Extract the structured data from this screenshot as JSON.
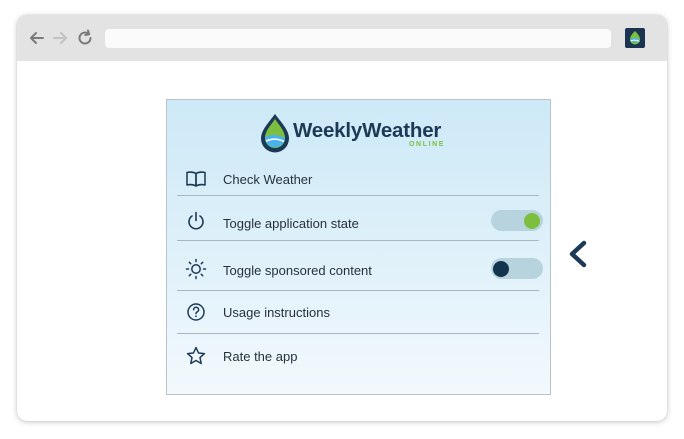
{
  "brand": {
    "name": "WeeklyWeather",
    "subtitle": "ONLINE",
    "colors": {
      "navy": "#1c3a56",
      "green": "#7cbf3f",
      "light_blue": "#cde9f7"
    }
  },
  "browser": {
    "back_icon": "arrow-left-icon",
    "forward_icon": "arrow-right-icon",
    "reload_icon": "reload-icon",
    "address_value": ""
  },
  "menu": {
    "items": [
      {
        "label": "Check Weather",
        "icon": "book-icon"
      },
      {
        "label": "Toggle application state",
        "icon": "power-icon",
        "toggle": true
      },
      {
        "label": "Toggle sponsored content",
        "icon": "sun-icon",
        "toggle": false
      },
      {
        "label": "Usage instructions",
        "icon": "help-circle-icon"
      },
      {
        "label": "Rate the app",
        "icon": "star-icon"
      }
    ]
  },
  "pointer_arrow": {
    "icon": "arrow-left-icon",
    "color": "#1c3a56"
  }
}
